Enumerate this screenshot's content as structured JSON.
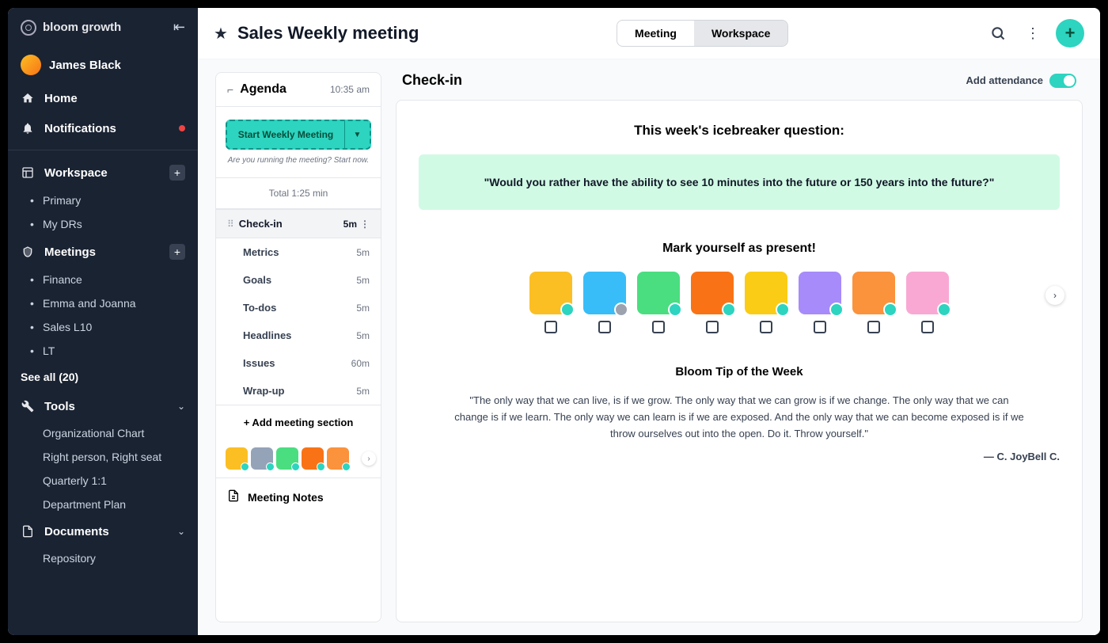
{
  "brand": {
    "name": "bloom growth"
  },
  "user": {
    "name": "James Black"
  },
  "nav": {
    "home": "Home",
    "notifications": "Notifications"
  },
  "sections": {
    "workspace": {
      "label": "Workspace",
      "items": [
        "Primary",
        "My DRs"
      ]
    },
    "meetings": {
      "label": "Meetings",
      "items": [
        "Finance",
        "Emma and Joanna",
        "Sales L10",
        "LT"
      ],
      "see_all": "See all (20)"
    },
    "tools": {
      "label": "Tools",
      "items": [
        "Organizational Chart",
        "Right person, Right seat",
        "Quarterly 1:1",
        "Department Plan"
      ]
    },
    "documents": {
      "label": "Documents",
      "items": [
        "Repository"
      ]
    }
  },
  "header": {
    "title": "Sales Weekly meeting",
    "tabs": {
      "meeting": "Meeting",
      "workspace": "Workspace"
    }
  },
  "agenda": {
    "title": "Agenda",
    "time": "10:35 am",
    "start_btn": "Start Weekly Meeting",
    "start_hint": "Are you running the meeting? Start now.",
    "total": "Total 1:25 min",
    "items": [
      {
        "name": "Check-in",
        "dur": "5m",
        "active": true
      },
      {
        "name": "Metrics",
        "dur": "5m"
      },
      {
        "name": "Goals",
        "dur": "5m"
      },
      {
        "name": "To-dos",
        "dur": "5m"
      },
      {
        "name": "Headlines",
        "dur": "5m"
      },
      {
        "name": "Issues",
        "dur": "60m"
      },
      {
        "name": "Wrap-up",
        "dur": "5m"
      }
    ],
    "add_section": "+ Add meeting section",
    "meeting_notes": "Meeting Notes"
  },
  "checkin": {
    "title": "Check-in",
    "attendance_label": "Add attendance",
    "icebreaker_heading": "This week's icebreaker question:",
    "icebreaker_q": "\"Would you rather have the ability to see 10 minutes into the future or 150 years into the future?\"",
    "present_heading": "Mark yourself as present!",
    "tip_heading": "Bloom Tip of the Week",
    "tip_quote": "\"The only way that we can live, is if we grow. The only way that we can grow is if we change. The only way that we can change is if we learn. The only way we can learn is if we are exposed. And the only way that we can become exposed is if we throw ourselves out into the open. Do it. Throw yourself.\"",
    "tip_author": "— C. JoyBell C."
  },
  "avatar_colors": [
    "#fbbf24",
    "#38bdf8",
    "#4ade80",
    "#f97316",
    "#facc15",
    "#a78bfa",
    "#fb923c",
    "#f9a8d4"
  ],
  "mini_avatar_colors": [
    "#fbbf24",
    "#94a3b8",
    "#4ade80",
    "#f97316",
    "#fb923c"
  ]
}
